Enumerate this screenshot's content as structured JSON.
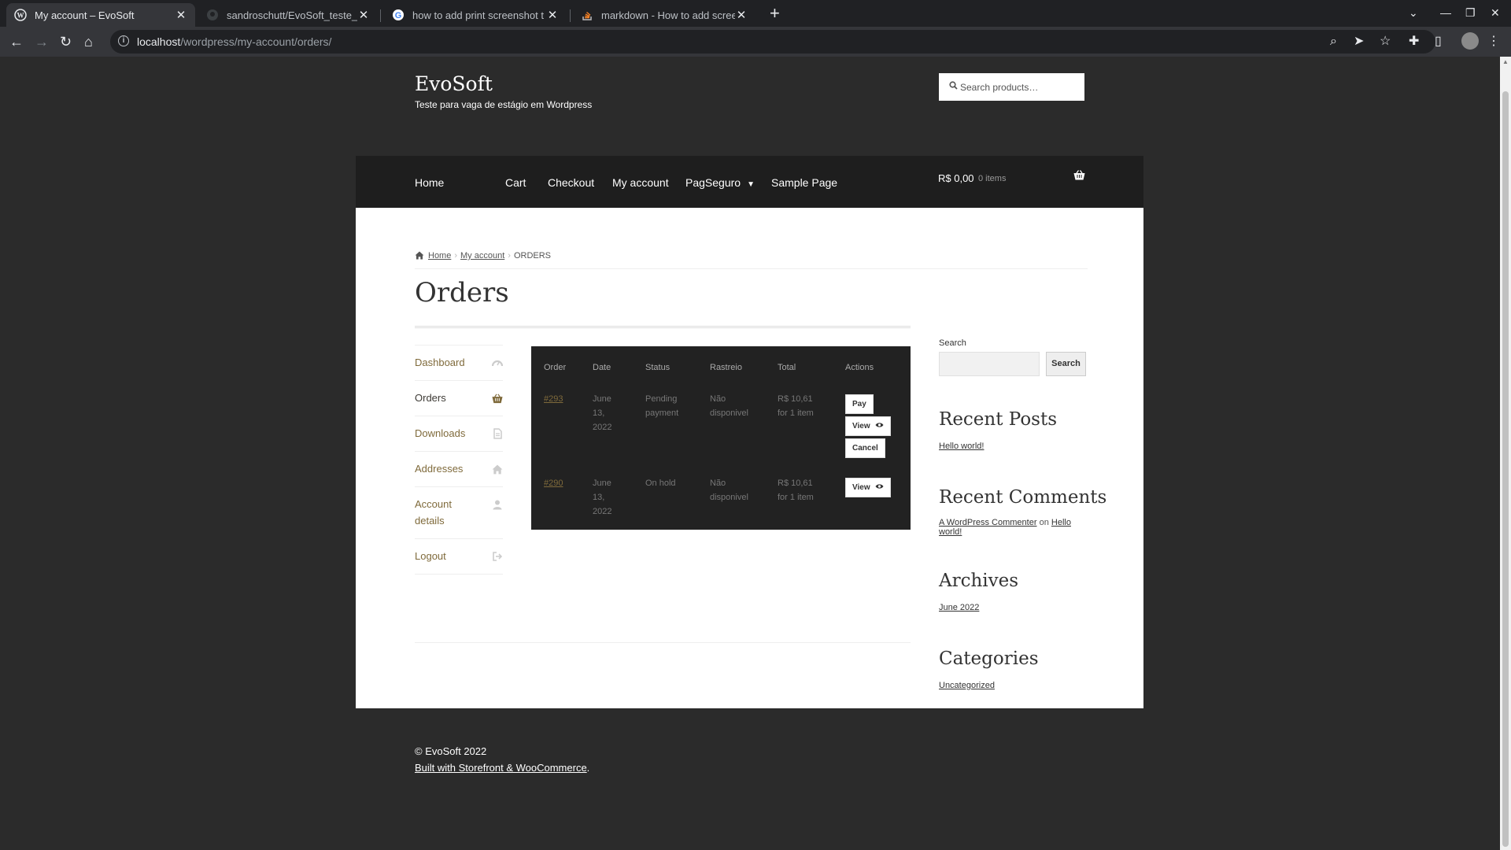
{
  "browser": {
    "tabs": [
      {
        "title": "My account – EvoSoft",
        "icon": "wordpress-icon"
      },
      {
        "title": "sandroschutt/EvoSoft_teste_",
        "icon": "github-icon"
      },
      {
        "title": "how to add print screenshot t",
        "icon": "google-icon"
      },
      {
        "title": "markdown - How to add scree",
        "icon": "stackoverflow-icon"
      }
    ],
    "url_host": "localhost",
    "url_path": "/wordpress/my-account/orders/"
  },
  "site": {
    "title": "EvoSoft",
    "description": "Teste para vaga de estágio em Wordpress",
    "search_placeholder": "Search products…"
  },
  "nav": {
    "items": [
      "Home",
      "Cart",
      "Checkout",
      "My account",
      "PagSeguro",
      "Sample Page"
    ],
    "cart_total": "R$ 0,00",
    "cart_count": "0 items"
  },
  "breadcrumb": {
    "home": "Home",
    "account": "My account",
    "current": "ORDERS"
  },
  "page_title": "Orders",
  "account_nav": [
    {
      "label": "Dashboard",
      "icon": "dashboard-icon"
    },
    {
      "label": "Orders",
      "icon": "basket-icon"
    },
    {
      "label": "Downloads",
      "icon": "file-icon"
    },
    {
      "label": "Addresses",
      "icon": "home-icon"
    },
    {
      "label": "Account details",
      "icon": "user-icon"
    },
    {
      "label": "Logout",
      "icon": "logout-icon"
    }
  ],
  "orders_table": {
    "headers": [
      "Order",
      "Date",
      "Status",
      "Rastreio",
      "Total",
      "Actions"
    ],
    "rows": [
      {
        "order": "#293",
        "date": [
          "June",
          "13,",
          "2022"
        ],
        "status": [
          "Pending",
          "payment"
        ],
        "rastreio": [
          "Não",
          "disponivel"
        ],
        "total": [
          "R$ 10,61",
          "for 1 item"
        ],
        "actions": [
          "Pay",
          "View",
          "Cancel"
        ]
      },
      {
        "order": "#290",
        "date": [
          "June",
          "13,",
          "2022"
        ],
        "status": [
          "On hold"
        ],
        "rastreio": [
          "Não",
          "disponivel"
        ],
        "total": [
          "R$ 10,61",
          "for 1 item"
        ],
        "actions": [
          "View"
        ]
      }
    ]
  },
  "sidebar": {
    "search_label": "Search",
    "search_button": "Search",
    "recent_posts_title": "Recent Posts",
    "recent_posts": [
      "Hello world!"
    ],
    "recent_comments_title": "Recent Comments",
    "comment_author": "A WordPress Commenter",
    "comment_on": "on",
    "comment_post": "Hello world!",
    "archives_title": "Archives",
    "archives": [
      "June 2022"
    ],
    "categories_title": "Categories",
    "categories": [
      "Uncategorized"
    ]
  },
  "footer": {
    "copyright": "© EvoSoft 2022",
    "built_with": "Built with Storefront & WooCommerce",
    "built_suffix": "."
  },
  "colors": {
    "link_gold": "#7f6a3b",
    "page_dark": "#2b2b2b",
    "nav_dark": "#1e1e1e",
    "table_dark": "#222222"
  }
}
